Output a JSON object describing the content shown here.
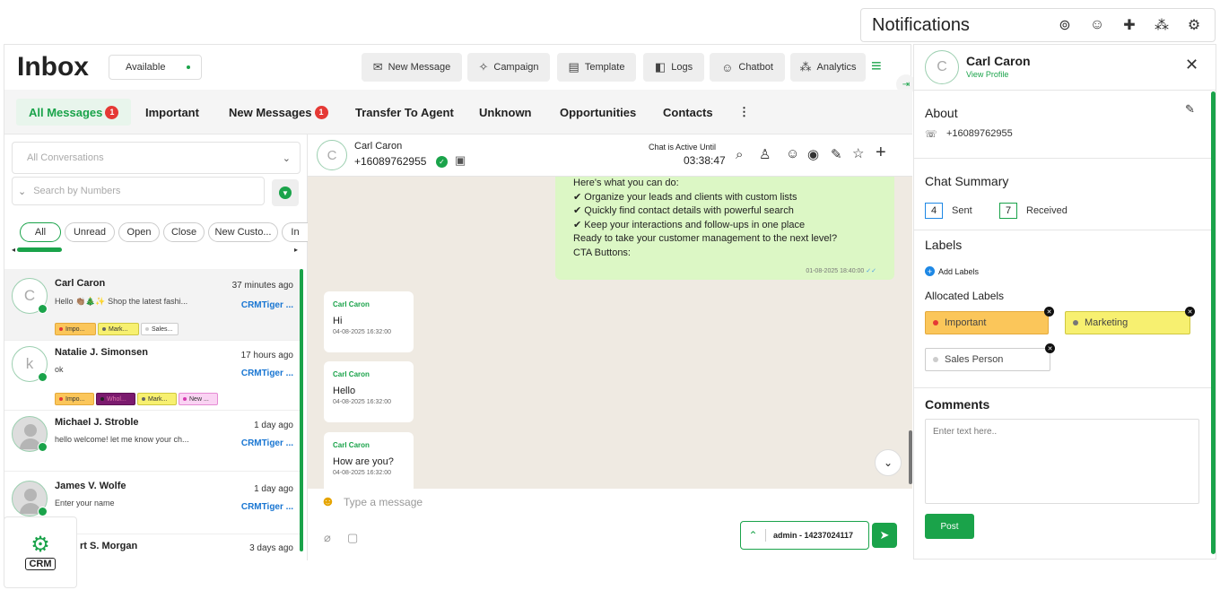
{
  "notifications": {
    "title": "Notifications",
    "icons": [
      "eye-check-icon",
      "chat-bot-icon",
      "chat-plus-icon",
      "analytics-icon",
      "settings-icon"
    ]
  },
  "header": {
    "title": "Inbox",
    "status": "Available",
    "buttons": [
      "New Message",
      "Campaign",
      "Template",
      "Logs",
      "Chatbot",
      "Analytics"
    ]
  },
  "tabs": [
    {
      "label": "All Messages",
      "badge": "1"
    },
    {
      "label": "Important"
    },
    {
      "label": "New Messages",
      "badge": "1"
    },
    {
      "label": "Transfer To Agent"
    },
    {
      "label": "Unknown"
    },
    {
      "label": "Opportunities"
    },
    {
      "label": "Contacts"
    }
  ],
  "conversation_list": {
    "select_placeholder": "All Conversations",
    "search_placeholder": "Search by Numbers",
    "filters": [
      "All",
      "Unread",
      "Open",
      "Close",
      "New Custo...",
      "In"
    ],
    "rows": [
      {
        "name": "Carl Caron",
        "initial": "C",
        "time": "37 minutes ago",
        "message": "Hello 👏🏽🎄✨ Shop the latest fashi...",
        "agent": "CRMTiger ...",
        "labels": [
          "Impo...",
          "Mark...",
          "Sales..."
        ]
      },
      {
        "name": "Natalie J. Simonsen",
        "initial": "k",
        "time": "17 hours ago",
        "message": "ok",
        "agent": "CRMTiger ...",
        "labels": [
          "Impo...",
          "Whol...",
          "Mark...",
          "New ..."
        ]
      },
      {
        "name": "Michael J. Stroble",
        "time": "1 day ago",
        "message": "hello welcome! let me know your ch...",
        "agent": "CRMTiger ..."
      },
      {
        "name": "James V. Wolfe",
        "time": "1 day ago",
        "message": "Enter your name",
        "agent": "CRMTiger ..."
      },
      {
        "name": "rt S. Morgan",
        "time": "3 days ago"
      }
    ]
  },
  "chat": {
    "contact_name": "Carl Caron",
    "contact_initial": "C",
    "contact_phone": "+16089762955",
    "active_label": "Chat is Active Until",
    "active_timer": "03:38:47",
    "outgoing": {
      "lines": [
        "Here's what you can do:",
        "✔ Organize your leads and clients with custom lists",
        "✔ Quickly find contact details with powerful search",
        "✔ Keep your interactions and follow-ups in one place",
        "Ready to take your customer management to the next level?",
        "CTA Buttons:"
      ],
      "time": "01-08-2025 18:40:00"
    },
    "incoming": [
      {
        "sender": "Carl Caron",
        "text": "Hi",
        "time": "04-08-2025 16:32:00"
      },
      {
        "sender": "Carl Caron",
        "text": "Hello",
        "time": "04-08-2025 16:32:00"
      },
      {
        "sender": "Carl Caron",
        "text": "How are you?",
        "time": "04-08-2025 16:32:00"
      }
    ],
    "input_placeholder": "Type a message",
    "sender_select": "admin - 14237024117"
  },
  "profile": {
    "name": "Carl Caron",
    "initial": "C",
    "link": "View Profile",
    "about_title": "About",
    "phone": "+16089762955",
    "summary_title": "Chat Summary",
    "sent_count": "4",
    "sent_label": "Sent",
    "received_count": "7",
    "received_label": "Received",
    "labels_title": "Labels",
    "add_labels": "Add Labels",
    "allocated_title": "Allocated Labels",
    "labels": [
      "Important",
      "Marketing",
      "Sales Person"
    ],
    "comments_title": "Comments",
    "comments_placeholder": "Enter text here..",
    "post_label": "Post"
  },
  "crm_badge": "CRM",
  "colors": {
    "brand_green": "#1aa34a",
    "badge_red": "#e53935",
    "important_orange": "#fbc65a",
    "marketing_yellow": "#f7f070",
    "link_blue": "#1976d2"
  }
}
